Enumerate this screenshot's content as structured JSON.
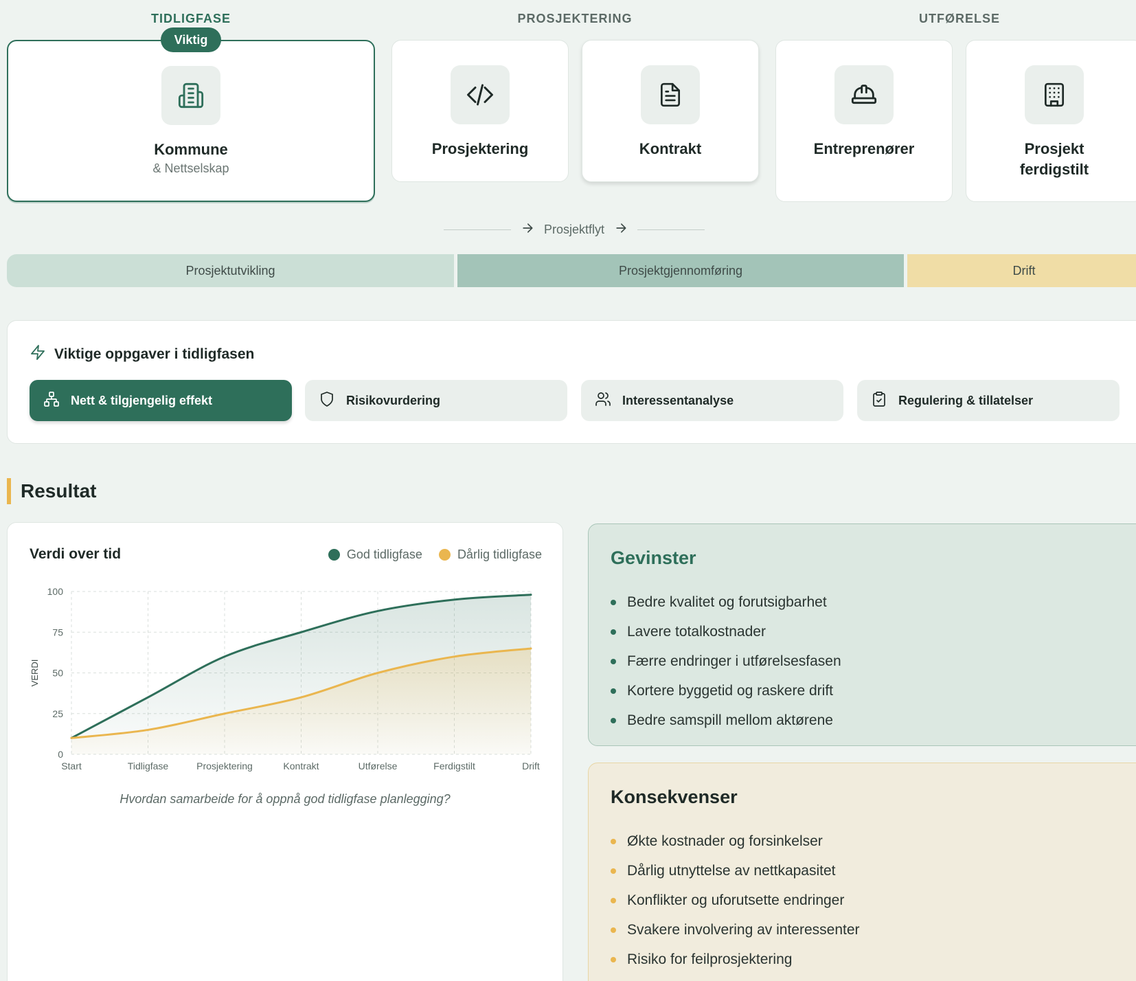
{
  "phases": {
    "tidligfase": "TIDLIGFASE",
    "prosjektering": "PROSJEKTERING",
    "utforelse": "UTFØRELSE"
  },
  "badge": "Viktig",
  "cards": [
    {
      "title": "Kommune",
      "subtitle": "& Nettselskap",
      "icon": "building-icon"
    },
    {
      "title": "Prosjektering",
      "icon": "code-icon"
    },
    {
      "title": "Kontrakt",
      "icon": "document-icon"
    },
    {
      "title": "Entreprenører",
      "icon": "hard-hat-icon"
    },
    {
      "title": "Prosjekt ferdigstilt",
      "icon": "office-building-icon"
    }
  ],
  "flow_label": "Prosjektflyt",
  "phase_bars": [
    "Prosjektutvikling",
    "Prosjektgjennomføring",
    "Drift"
  ],
  "tasks": {
    "title": "Viktige oppgaver i tidligfasen",
    "items": [
      {
        "label": "Nett & tilgjengelig effekt",
        "icon": "network-icon",
        "active": true
      },
      {
        "label": "Risikovurdering",
        "icon": "shield-icon",
        "active": false
      },
      {
        "label": "Interessentanalyse",
        "icon": "users-icon",
        "active": false
      },
      {
        "label": "Regulering & tillatelser",
        "icon": "clipboard-check-icon",
        "active": false
      }
    ]
  },
  "result_title": "Resultat",
  "chart_data": {
    "type": "area",
    "title": "Verdi over tid",
    "ylabel": "VERDI",
    "xlabel": "",
    "categories": [
      "Start",
      "Tidligfase",
      "Prosjektering",
      "Kontrakt",
      "Utførelse",
      "Ferdigstilt",
      "Drift"
    ],
    "ylim": [
      0,
      100
    ],
    "yticks": [
      0,
      25,
      50,
      75,
      100
    ],
    "grid": true,
    "legend": "top-right",
    "series": [
      {
        "name": "God tidligfase",
        "color": "#2e6f5a",
        "values": [
          10,
          35,
          60,
          75,
          88,
          95,
          98
        ]
      },
      {
        "name": "Dårlig tidligfase",
        "color": "#eab64f",
        "values": [
          10,
          15,
          25,
          35,
          50,
          60,
          65
        ]
      }
    ],
    "caption": "Hvordan samarbeide for å oppnå god tidligfase planlegging?"
  },
  "gains": {
    "title": "Gevinster",
    "color": "#2e6f5a",
    "items": [
      "Bedre kvalitet og forutsigbarhet",
      "Lavere totalkostnader",
      "Færre endringer i utførelsesfasen",
      "Kortere byggetid og raskere drift",
      "Bedre samspill mellom aktørene"
    ]
  },
  "consequences": {
    "title": "Konsekvenser",
    "color": "#eab64f",
    "items": [
      "Økte kostnader og forsinkelser",
      "Dårlig utnyttelse av nettkapasitet",
      "Konflikter og uforutsette endringer",
      "Svakere involvering av interessenter",
      "Risiko for feilprosjektering"
    ]
  }
}
